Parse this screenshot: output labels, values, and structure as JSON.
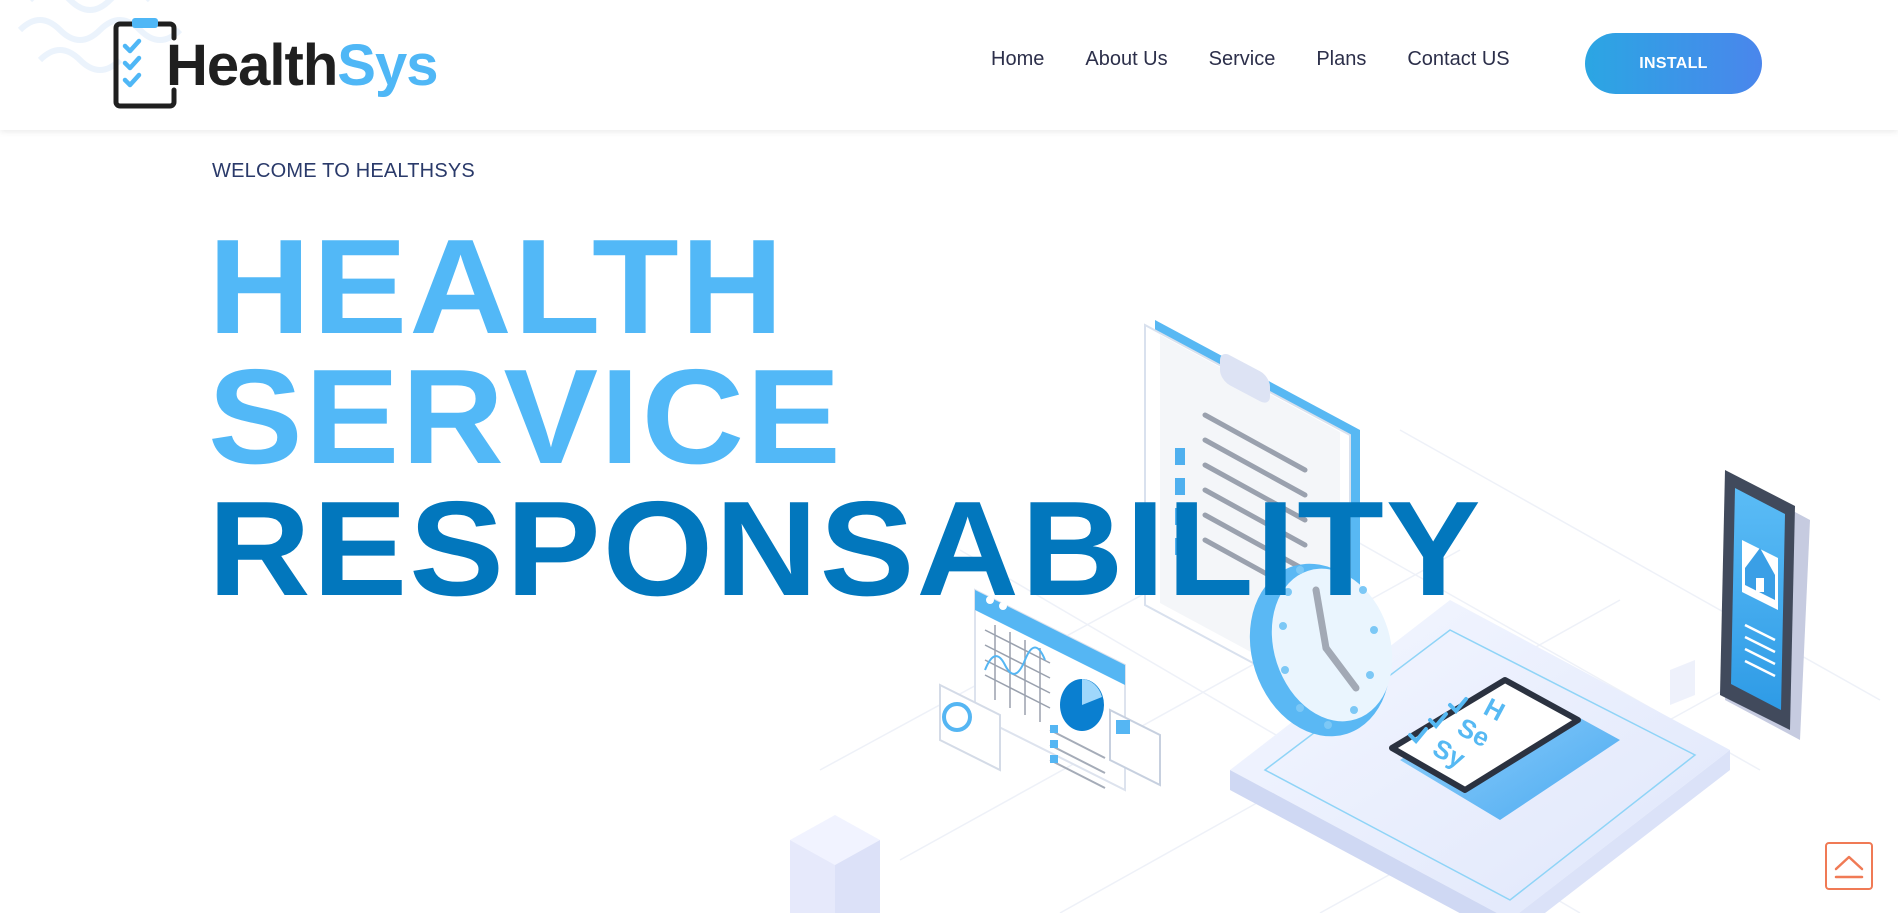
{
  "brand": {
    "name_part1": "Health",
    "name_part2": "Sys",
    "icon": "clipboard-checklist-icon",
    "colors": {
      "dark": "#1f1f1f",
      "light_blue": "#4fb7f6",
      "accent_blue": "#0277bd"
    }
  },
  "nav": {
    "items": [
      {
        "label": "Home"
      },
      {
        "label": "About Us"
      },
      {
        "label": "Service"
      },
      {
        "label": "Plans"
      },
      {
        "label": "Contact US"
      }
    ],
    "install_label": "INSTALL"
  },
  "hero": {
    "welcome": "WELCOME TO HEALTHSYS",
    "line1": "HEALTH",
    "line2": "SERVICE",
    "line3": "RESPONSABILITY",
    "tablet_letters": [
      "H",
      "Se",
      "Sy"
    ]
  },
  "scroll_top": {
    "icon": "chevron-up-icon"
  }
}
